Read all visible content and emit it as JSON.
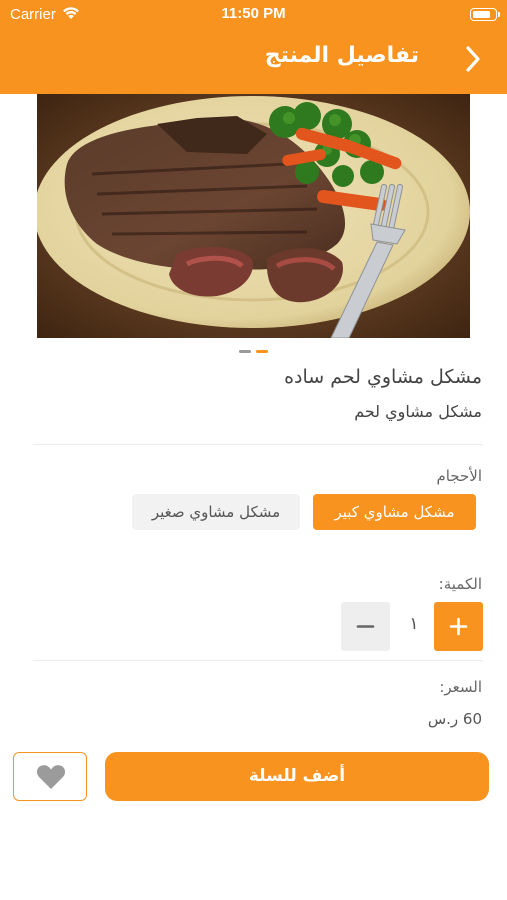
{
  "colors": {
    "accent": "#F7931E",
    "muted_button": "#EEEEEE",
    "chip_inactive": "#F2F2F2",
    "page_bg": "#FFFFFF"
  },
  "status_bar": {
    "carrier": "Carrier",
    "time": "11:50 PM",
    "battery_level": 0.85
  },
  "header": {
    "title": "تفاصيل المنتج",
    "back_icon": "chevron-right-icon"
  },
  "gallery": {
    "image_subject": "grilled steak with broccoli and carrots on a plate",
    "page_count": 2,
    "active_page": 2
  },
  "product": {
    "name": "مشكل مشاوي لحم ساده",
    "subtitle": "مشكل مشاوي لحم"
  },
  "sizes": {
    "label": "الأحجام",
    "options": [
      {
        "label": "مشكل مشاوي كبير",
        "selected": true
      },
      {
        "label": "مشكل مشاوي صغير",
        "selected": false
      }
    ]
  },
  "quantity": {
    "label": "الكمية:",
    "value": "١",
    "plus_icon": "plus-icon",
    "minus_icon": "minus-icon"
  },
  "price": {
    "label": "السعر:",
    "value": "60 ر.س"
  },
  "actions": {
    "add_to_cart_label": "أضف للسلة",
    "favorite_icon": "heart-icon"
  }
}
